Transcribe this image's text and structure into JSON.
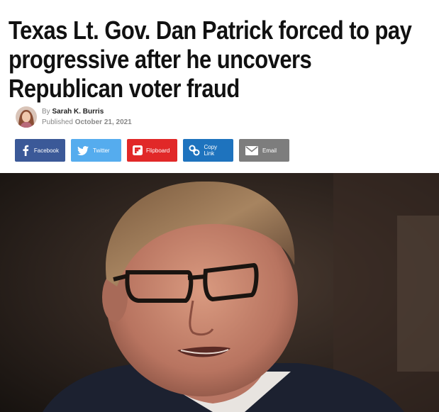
{
  "article": {
    "headline": "Texas Lt. Gov. Dan Patrick forced to pay progressive after he uncovers Republican voter fraud",
    "by_prefix": "By",
    "author": "Sarah K. Burris",
    "published_prefix": "Published",
    "date": "October 21, 2021"
  },
  "share": {
    "facebook": "Facebook",
    "twitter": "Twitter",
    "flipboard": "Flipboard",
    "copy_link": "Copy Link",
    "email": "Email"
  },
  "icons": {
    "facebook": "facebook-icon",
    "twitter": "twitter-icon",
    "flipboard": "flipboard-icon",
    "copy_link": "link-icon",
    "email": "envelope-icon"
  },
  "colors": {
    "facebook": "#3b5998",
    "twitter": "#55acee",
    "flipboard": "#e12828",
    "copy_link": "#1e73be",
    "email": "#7d7d7d"
  }
}
